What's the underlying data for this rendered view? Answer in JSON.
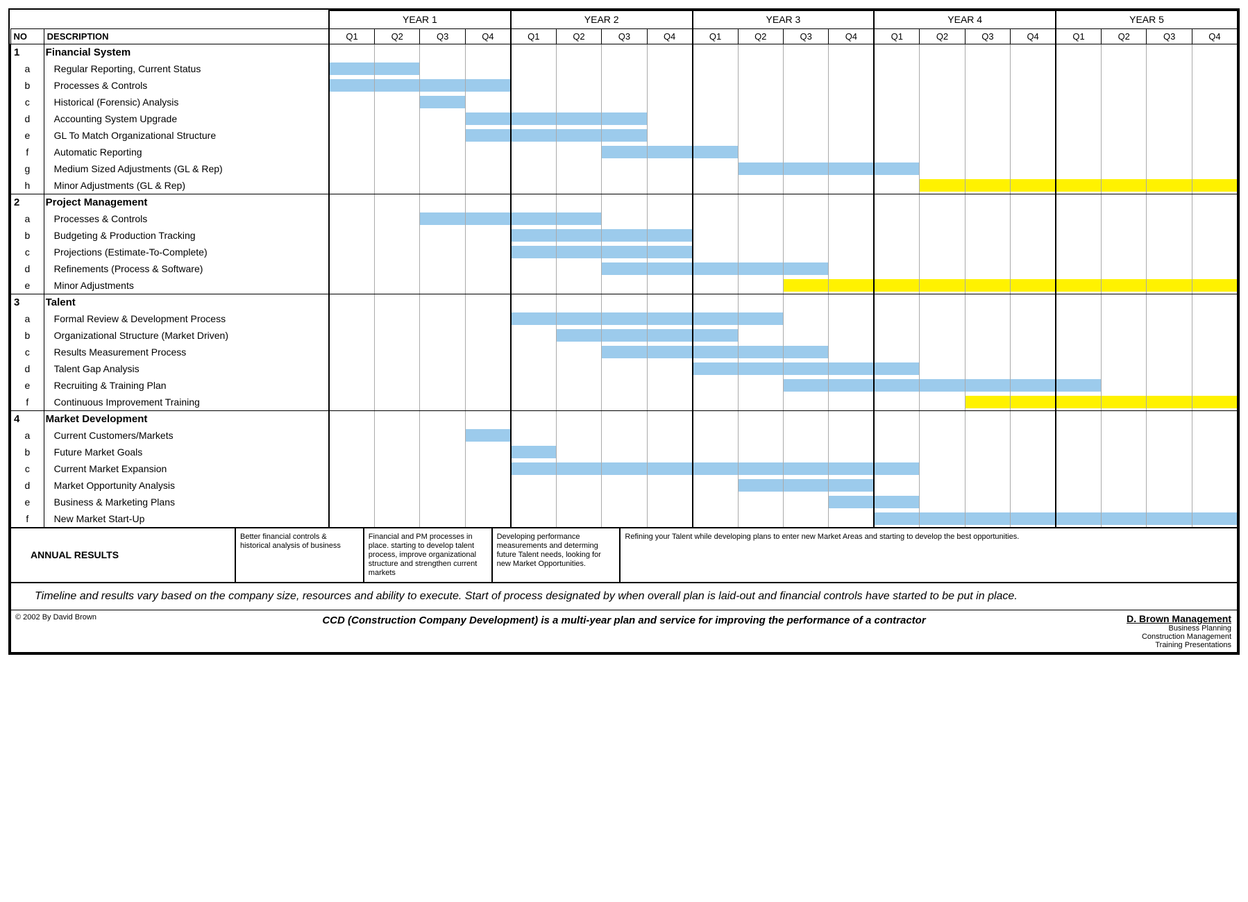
{
  "headers": {
    "no": "NO",
    "desc": "DESCRIPTION",
    "years": [
      "YEAR 1",
      "YEAR 2",
      "YEAR 3",
      "YEAR 4",
      "YEAR 5"
    ],
    "quarters": [
      "Q1",
      "Q2",
      "Q3",
      "Q4"
    ]
  },
  "sections": [
    {
      "no": "1",
      "title": "Financial System",
      "rows": [
        {
          "id": "a",
          "label": "Regular Reporting, Current Status"
        },
        {
          "id": "b",
          "label": "Processes & Controls"
        },
        {
          "id": "c",
          "label": "Historical (Forensic) Analysis"
        },
        {
          "id": "d",
          "label": "Accounting System Upgrade"
        },
        {
          "id": "e",
          "label": "GL To Match Organizational Structure"
        },
        {
          "id": "f",
          "label": "Automatic Reporting"
        },
        {
          "id": "g",
          "label": "Medium Sized Adjustments (GL & Rep)"
        },
        {
          "id": "h",
          "label": "Minor Adjustments (GL & Rep)"
        }
      ]
    },
    {
      "no": "2",
      "title": "Project Management",
      "rows": [
        {
          "id": "a",
          "label": "Processes & Controls"
        },
        {
          "id": "b",
          "label": "Budgeting & Production Tracking"
        },
        {
          "id": "c",
          "label": "Projections (Estimate-To-Complete)"
        },
        {
          "id": "d",
          "label": "Refinements (Process & Software)"
        },
        {
          "id": "e",
          "label": "Minor Adjustments"
        }
      ]
    },
    {
      "no": "3",
      "title": "Talent",
      "rows": [
        {
          "id": "a",
          "label": "Formal Review & Development Process"
        },
        {
          "id": "b",
          "label": "Organizational Structure (Market Driven)"
        },
        {
          "id": "c",
          "label": "Results Measurement Process"
        },
        {
          "id": "d",
          "label": "Talent Gap Analysis"
        },
        {
          "id": "e",
          "label": "Recruiting & Training Plan"
        },
        {
          "id": "f",
          "label": "Continuous Improvement Training"
        }
      ]
    },
    {
      "no": "4",
      "title": "Market Development",
      "rows": [
        {
          "id": "a",
          "label": "Current Customers/Markets"
        },
        {
          "id": "b",
          "label": "Future Market Goals"
        },
        {
          "id": "c",
          "label": "Current Market Expansion"
        },
        {
          "id": "d",
          "label": "Market Opportunity Analysis"
        },
        {
          "id": "e",
          "label": "Business & Marketing Plans"
        },
        {
          "id": "f",
          "label": "New Market Start-Up"
        }
      ]
    }
  ],
  "annual": {
    "label": "ANNUAL RESULTS",
    "y1": "Better financial controls & historical analysis of business",
    "y2": "Financial and PM processes in place. starting to develop talent process, improve organizational structure and strengthen current markets",
    "y3": "Developing performance measurements and determing future Talent needs, looking for new Market Opportunities.",
    "y45": "Refining your Talent while developing plans to enter new Market Areas and starting to develop the best opportunities."
  },
  "note": "Timeline and results vary based on the company size, resources and ability to execute.  Start of process designated by when overall plan is laid-out and financial controls have started to be put in place.",
  "footer": {
    "copy": "© 2002 By David Brown",
    "tag": "CCD (Construction Company Development) is a multi-year plan and service for improving the performance of a contractor",
    "brand_name": "D. Brown Management",
    "brand_l1": "Business Planning",
    "brand_l2": "Construction Management",
    "brand_l3": "Training Presentations"
  },
  "chart_data": {
    "type": "gantt",
    "time_unit": "quarter",
    "xlabel": "Year / Quarter",
    "x_range": [
      1,
      20
    ],
    "colors": {
      "blue": "#9ccbec",
      "yellow": "#fff200"
    },
    "tasks": [
      {
        "section": "Financial System",
        "id": "1a",
        "label": "Regular Reporting, Current Status",
        "start": 1,
        "end": 2,
        "color": "blue"
      },
      {
        "section": "Financial System",
        "id": "1b",
        "label": "Processes & Controls",
        "start": 1,
        "end": 4,
        "color": "blue"
      },
      {
        "section": "Financial System",
        "id": "1c",
        "label": "Historical (Forensic) Analysis",
        "start": 3,
        "end": 3,
        "color": "blue"
      },
      {
        "section": "Financial System",
        "id": "1d",
        "label": "Accounting System Upgrade",
        "start": 4,
        "end": 7,
        "color": "blue"
      },
      {
        "section": "Financial System",
        "id": "1e",
        "label": "GL To Match Organizational Structure",
        "start": 4,
        "end": 7,
        "color": "blue"
      },
      {
        "section": "Financial System",
        "id": "1f",
        "label": "Automatic Reporting",
        "start": 7,
        "end": 9,
        "color": "blue"
      },
      {
        "section": "Financial System",
        "id": "1g",
        "label": "Medium Sized Adjustments (GL & Rep)",
        "start": 10,
        "end": 13,
        "color": "blue"
      },
      {
        "section": "Financial System",
        "id": "1h",
        "label": "Minor Adjustments (GL & Rep)",
        "start": 14,
        "end": 20,
        "color": "yellow"
      },
      {
        "section": "Project Management",
        "id": "2a",
        "label": "Processes & Controls",
        "start": 3,
        "end": 6,
        "color": "blue"
      },
      {
        "section": "Project Management",
        "id": "2b",
        "label": "Budgeting & Production Tracking",
        "start": 5,
        "end": 8,
        "color": "blue"
      },
      {
        "section": "Project Management",
        "id": "2c",
        "label": "Projections (Estimate-To-Complete)",
        "start": 5,
        "end": 8,
        "color": "blue"
      },
      {
        "section": "Project Management",
        "id": "2d",
        "label": "Refinements (Process & Software)",
        "start": 7,
        "end": 11,
        "color": "blue"
      },
      {
        "section": "Project Management",
        "id": "2e",
        "label": "Minor Adjustments",
        "start": 11,
        "end": 20,
        "color": "yellow"
      },
      {
        "section": "Talent",
        "id": "3a",
        "label": "Formal Review & Development Process",
        "start": 5,
        "end": 10,
        "color": "blue"
      },
      {
        "section": "Talent",
        "id": "3b",
        "label": "Organizational Structure (Market Driven)",
        "start": 6,
        "end": 9,
        "color": "blue"
      },
      {
        "section": "Talent",
        "id": "3c",
        "label": "Results Measurement Process",
        "start": 7,
        "end": 11,
        "color": "blue"
      },
      {
        "section": "Talent",
        "id": "3d",
        "label": "Talent Gap Analysis",
        "start": 9,
        "end": 13,
        "color": "blue"
      },
      {
        "section": "Talent",
        "id": "3e",
        "label": "Recruiting & Training Plan",
        "start": 11,
        "end": 17,
        "color": "blue"
      },
      {
        "section": "Talent",
        "id": "3f",
        "label": "Continuous Improvement Training",
        "start": 15,
        "end": 20,
        "color": "yellow"
      },
      {
        "section": "Market Development",
        "id": "4a",
        "label": "Current Customers/Markets",
        "start": 4,
        "end": 4,
        "color": "blue"
      },
      {
        "section": "Market Development",
        "id": "4b",
        "label": "Future Market Goals",
        "start": 5,
        "end": 5,
        "color": "blue"
      },
      {
        "section": "Market Development",
        "id": "4c",
        "label": "Current Market Expansion",
        "start": 5,
        "end": 13,
        "color": "blue"
      },
      {
        "section": "Market Development",
        "id": "4d",
        "label": "Market Opportunity Analysis",
        "start": 10,
        "end": 12,
        "color": "blue"
      },
      {
        "section": "Market Development",
        "id": "4e",
        "label": "Business & Marketing Plans",
        "start": 12,
        "end": 13,
        "color": "blue"
      },
      {
        "section": "Market Development",
        "id": "4f",
        "label": "New Market Start-Up",
        "start": 13,
        "end": 20,
        "color": "blue"
      }
    ]
  }
}
